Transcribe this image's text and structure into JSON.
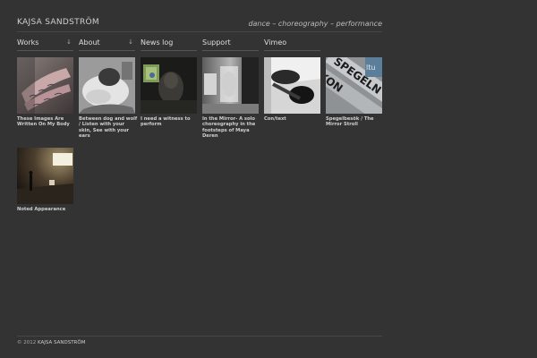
{
  "header": {
    "site_title": "KAJSA SANDSTRÖM",
    "tagline": "dance – choreography – performance"
  },
  "nav": {
    "works": "Works",
    "about": "About",
    "news": "News log",
    "support": "Support",
    "vimeo": "Vimeo",
    "dropdown_arrow": "↓"
  },
  "works": [
    {
      "title": "These Images Are Written On My Body"
    },
    {
      "title": "Between dog and wolf / Listen with your skin, See with your ears"
    },
    {
      "title": "I need a witness to perform"
    },
    {
      "title": "In the Mirror- A solo choreography in the footsteps of Maya Deren"
    },
    {
      "title": "Con/text"
    },
    {
      "title": "Spegelbesök / The Mirror Stroll"
    },
    {
      "title": "Noted Appearance"
    }
  ],
  "footer": {
    "copyright": "© 2012",
    "author": "KAJSA SANDSTRÖM"
  },
  "colors": {
    "background": "#333333",
    "text": "#cccccc",
    "rule": "#474747"
  }
}
